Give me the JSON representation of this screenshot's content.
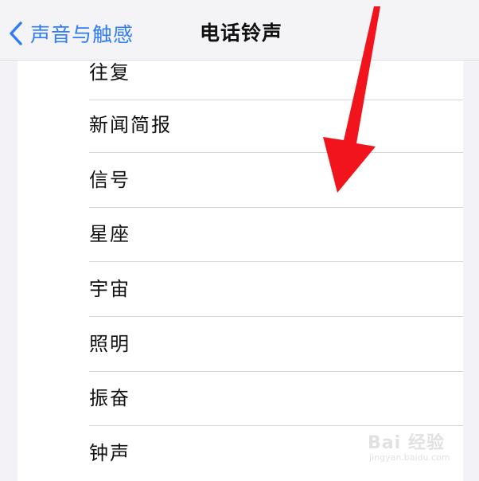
{
  "nav": {
    "back_label": "声音与触感",
    "title": "电话铃声"
  },
  "ringtones": [
    {
      "label": "往复"
    },
    {
      "label": "新闻简报"
    },
    {
      "label": "信号"
    },
    {
      "label": "星座"
    },
    {
      "label": "宇宙"
    },
    {
      "label": "照明"
    },
    {
      "label": "振奋"
    },
    {
      "label": "钟声"
    }
  ],
  "watermark": {
    "main": "Bai 经验",
    "sub": "jingyan.baidu.com"
  },
  "colors": {
    "accent": "#2f7cf6",
    "annotation_arrow": "#f2141c"
  }
}
